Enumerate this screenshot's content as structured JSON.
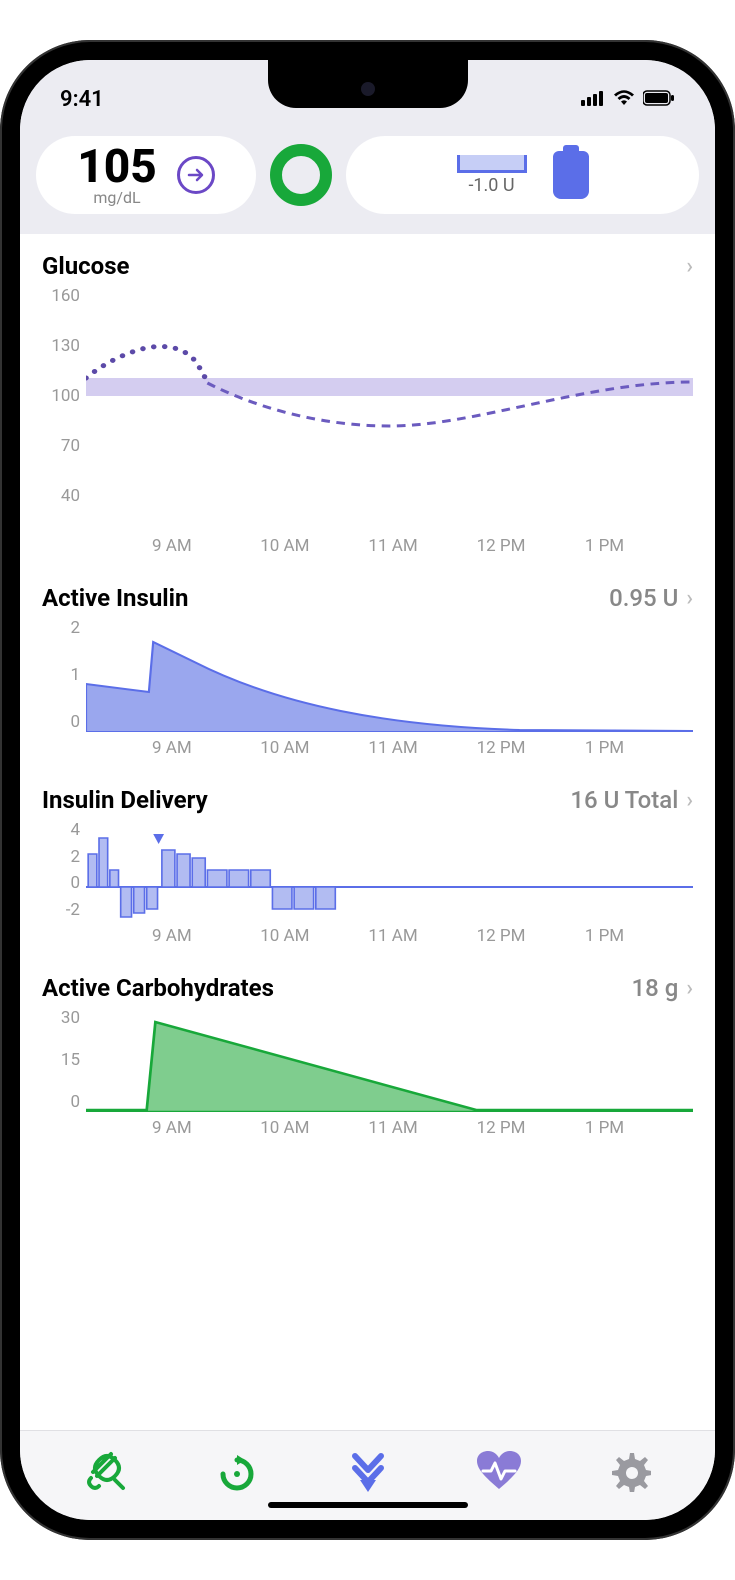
{
  "status": {
    "time": "9:41"
  },
  "header": {
    "glucose_value": "105",
    "glucose_unit": "mg/dL",
    "pump_delta": "-1.0 U"
  },
  "sections": {
    "glucose": {
      "title": "Glucose"
    },
    "insulin": {
      "title": "Active Insulin",
      "value": "0.95 U"
    },
    "delivery": {
      "title": "Insulin Delivery",
      "value": "16 U Total"
    },
    "carbs": {
      "title": "Active Carbohydrates",
      "value": "18 g"
    }
  },
  "axis": {
    "glucose_y": [
      "160",
      "130",
      "100",
      "70",
      "40"
    ],
    "insulin_y": [
      "2",
      "1",
      "0"
    ],
    "delivery_y": [
      "4",
      "2",
      "0",
      "-2"
    ],
    "carbs_y": [
      "30",
      "15",
      "0"
    ],
    "x": [
      "9 AM",
      "10 AM",
      "11 AM",
      "12 PM",
      "1 PM"
    ]
  },
  "chart_data": [
    {
      "type": "line",
      "title": "Glucose",
      "ylabel": "mg/dL",
      "ylim": [
        40,
        160
      ],
      "x_ticks": [
        "9 AM",
        "10 AM",
        "11 AM",
        "12 PM",
        "1 PM"
      ],
      "target_band": [
        100,
        110
      ],
      "series": [
        {
          "name": "historical",
          "style": "dotted",
          "x": [
            0,
            0.2,
            0.5,
            0.8,
            1.0
          ],
          "values": [
            110,
            120,
            124,
            118,
            110
          ]
        },
        {
          "name": "predicted",
          "style": "dashed",
          "x": [
            1.0,
            1.5,
            2.0,
            2.5,
            3.0,
            3.5,
            4.0,
            4.5,
            5.0,
            5.5
          ],
          "values": [
            110,
            104,
            98,
            94,
            93,
            95,
            100,
            104,
            107,
            108
          ]
        }
      ]
    },
    {
      "type": "area",
      "title": "Active Insulin",
      "ylabel": "U",
      "ylim": [
        0,
        2
      ],
      "x_ticks": [
        "9 AM",
        "10 AM",
        "11 AM",
        "12 PM",
        "1 PM"
      ],
      "x": [
        0,
        0.55,
        0.6,
        1.0,
        1.5,
        2.0,
        2.5,
        3.0,
        3.5,
        4.0,
        5.5
      ],
      "values": [
        0.85,
        0.7,
        1.58,
        1.25,
        0.8,
        0.5,
        0.3,
        0.16,
        0.08,
        0.03,
        0.0
      ]
    },
    {
      "type": "bar",
      "title": "Insulin Delivery",
      "ylabel": "U",
      "ylim": [
        -2,
        4
      ],
      "x_ticks": [
        "9 AM",
        "10 AM",
        "11 AM",
        "12 PM",
        "1 PM"
      ],
      "baseline": 0,
      "x": [
        0.05,
        0.15,
        0.25,
        0.35,
        0.45,
        0.55,
        0.7,
        0.85,
        1.0,
        1.2,
        1.4,
        1.6,
        1.8,
        2.0,
        2.2
      ],
      "values": [
        2.0,
        3.0,
        1.0,
        -1.8,
        -1.5,
        -1.2,
        2.2,
        2.0,
        1.8,
        1.0,
        1.0,
        1.0,
        -1.2,
        -1.2,
        -1.2
      ],
      "bolus_markers": [
        {
          "x": 0.6
        }
      ]
    },
    {
      "type": "area",
      "title": "Active Carbohydrates",
      "ylabel": "g",
      "ylim": [
        0,
        30
      ],
      "x_ticks": [
        "9 AM",
        "10 AM",
        "11 AM",
        "12 PM",
        "1 PM"
      ],
      "x": [
        0,
        0.55,
        0.6,
        1.5,
        2.5,
        3.5,
        4.0,
        5.5
      ],
      "values": [
        0,
        0,
        26,
        18,
        10,
        2,
        0,
        0
      ]
    }
  ]
}
